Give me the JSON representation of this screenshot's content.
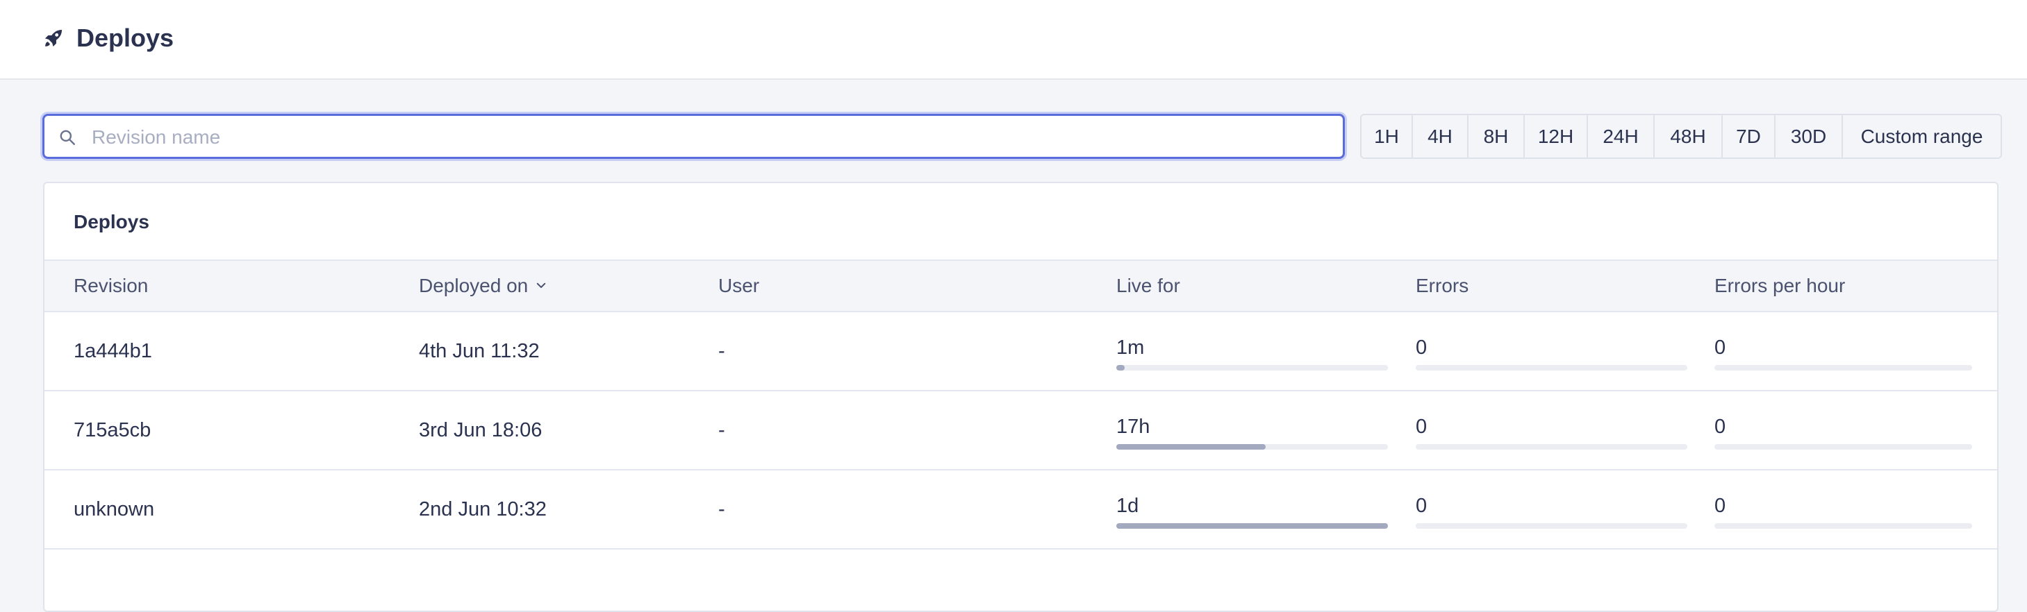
{
  "header": {
    "title": "Deploys",
    "icon": "rocket-icon"
  },
  "search": {
    "placeholder": "Revision name",
    "value": ""
  },
  "time_ranges": [
    "1H",
    "4H",
    "8H",
    "12H",
    "24H",
    "48H",
    "7D",
    "30D",
    "Custom range"
  ],
  "table": {
    "title": "Deploys",
    "columns": {
      "revision": "Revision",
      "deployed_on": "Deployed on",
      "user": "User",
      "live_for": "Live for",
      "errors": "Errors",
      "errors_per_hour": "Errors per hour"
    },
    "sorted_by": "deployed_on",
    "rows": [
      {
        "revision": "1a444b1",
        "deployed_on": "4th Jun 11:32",
        "user": "-",
        "live_for": "1m",
        "live_for_fraction": 0.03,
        "errors": "0",
        "errors_fraction": 0,
        "errors_per_hour": "0",
        "errors_per_hour_fraction": 0
      },
      {
        "revision": "715a5cb",
        "deployed_on": "3rd Jun 18:06",
        "user": "-",
        "live_for": "17h",
        "live_for_fraction": 0.55,
        "errors": "0",
        "errors_fraction": 0,
        "errors_per_hour": "0",
        "errors_per_hour_fraction": 0
      },
      {
        "revision": "unknown",
        "deployed_on": "2nd Jun 10:32",
        "user": "-",
        "live_for": "1d",
        "live_for_fraction": 1.0,
        "errors": "0",
        "errors_fraction": 0,
        "errors_per_hour": "0",
        "errors_per_hour_fraction": 0
      }
    ]
  },
  "colors": {
    "accent": "#5a6bdb",
    "bar_fill": "#a3a9bf",
    "bar_track": "#ebedf3"
  }
}
